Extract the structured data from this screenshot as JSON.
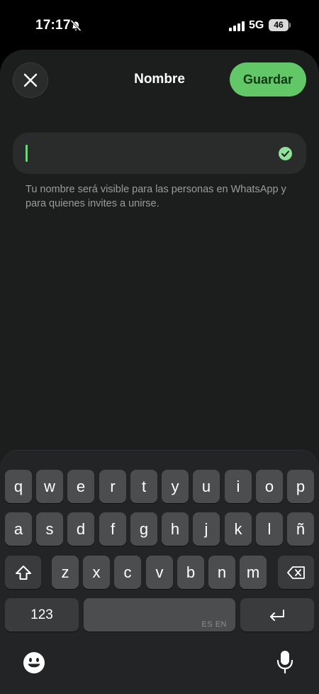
{
  "status_bar": {
    "time": "17:17",
    "network": "5G",
    "battery": "46",
    "icons": [
      "bell-slash-icon",
      "cellular-signal-icon",
      "battery-icon"
    ]
  },
  "header": {
    "title": "Nombre",
    "save_label": "Guardar",
    "close_icon": "close-icon"
  },
  "name_field": {
    "value": "",
    "status_icon": "checkmark-circle-icon"
  },
  "helper_text": "Tu nombre será visible para las personas en WhatsApp y para quienes invites a unirse.",
  "keyboard": {
    "row1": [
      "q",
      "w",
      "e",
      "r",
      "t",
      "y",
      "u",
      "i",
      "o",
      "p"
    ],
    "row2": [
      "a",
      "s",
      "d",
      "f",
      "g",
      "h",
      "j",
      "k",
      "l",
      "ñ"
    ],
    "row3": [
      "z",
      "x",
      "c",
      "v",
      "b",
      "n",
      "m"
    ],
    "numbers_label": "123",
    "space_hint": "ES EN",
    "icons": [
      "shift-icon",
      "backspace-icon",
      "return-icon",
      "emoji-icon",
      "microphone-icon"
    ]
  },
  "colors": {
    "accent_green": "#62c767",
    "background": "#1c1d1d",
    "helper_text": "#9a9c9c"
  }
}
